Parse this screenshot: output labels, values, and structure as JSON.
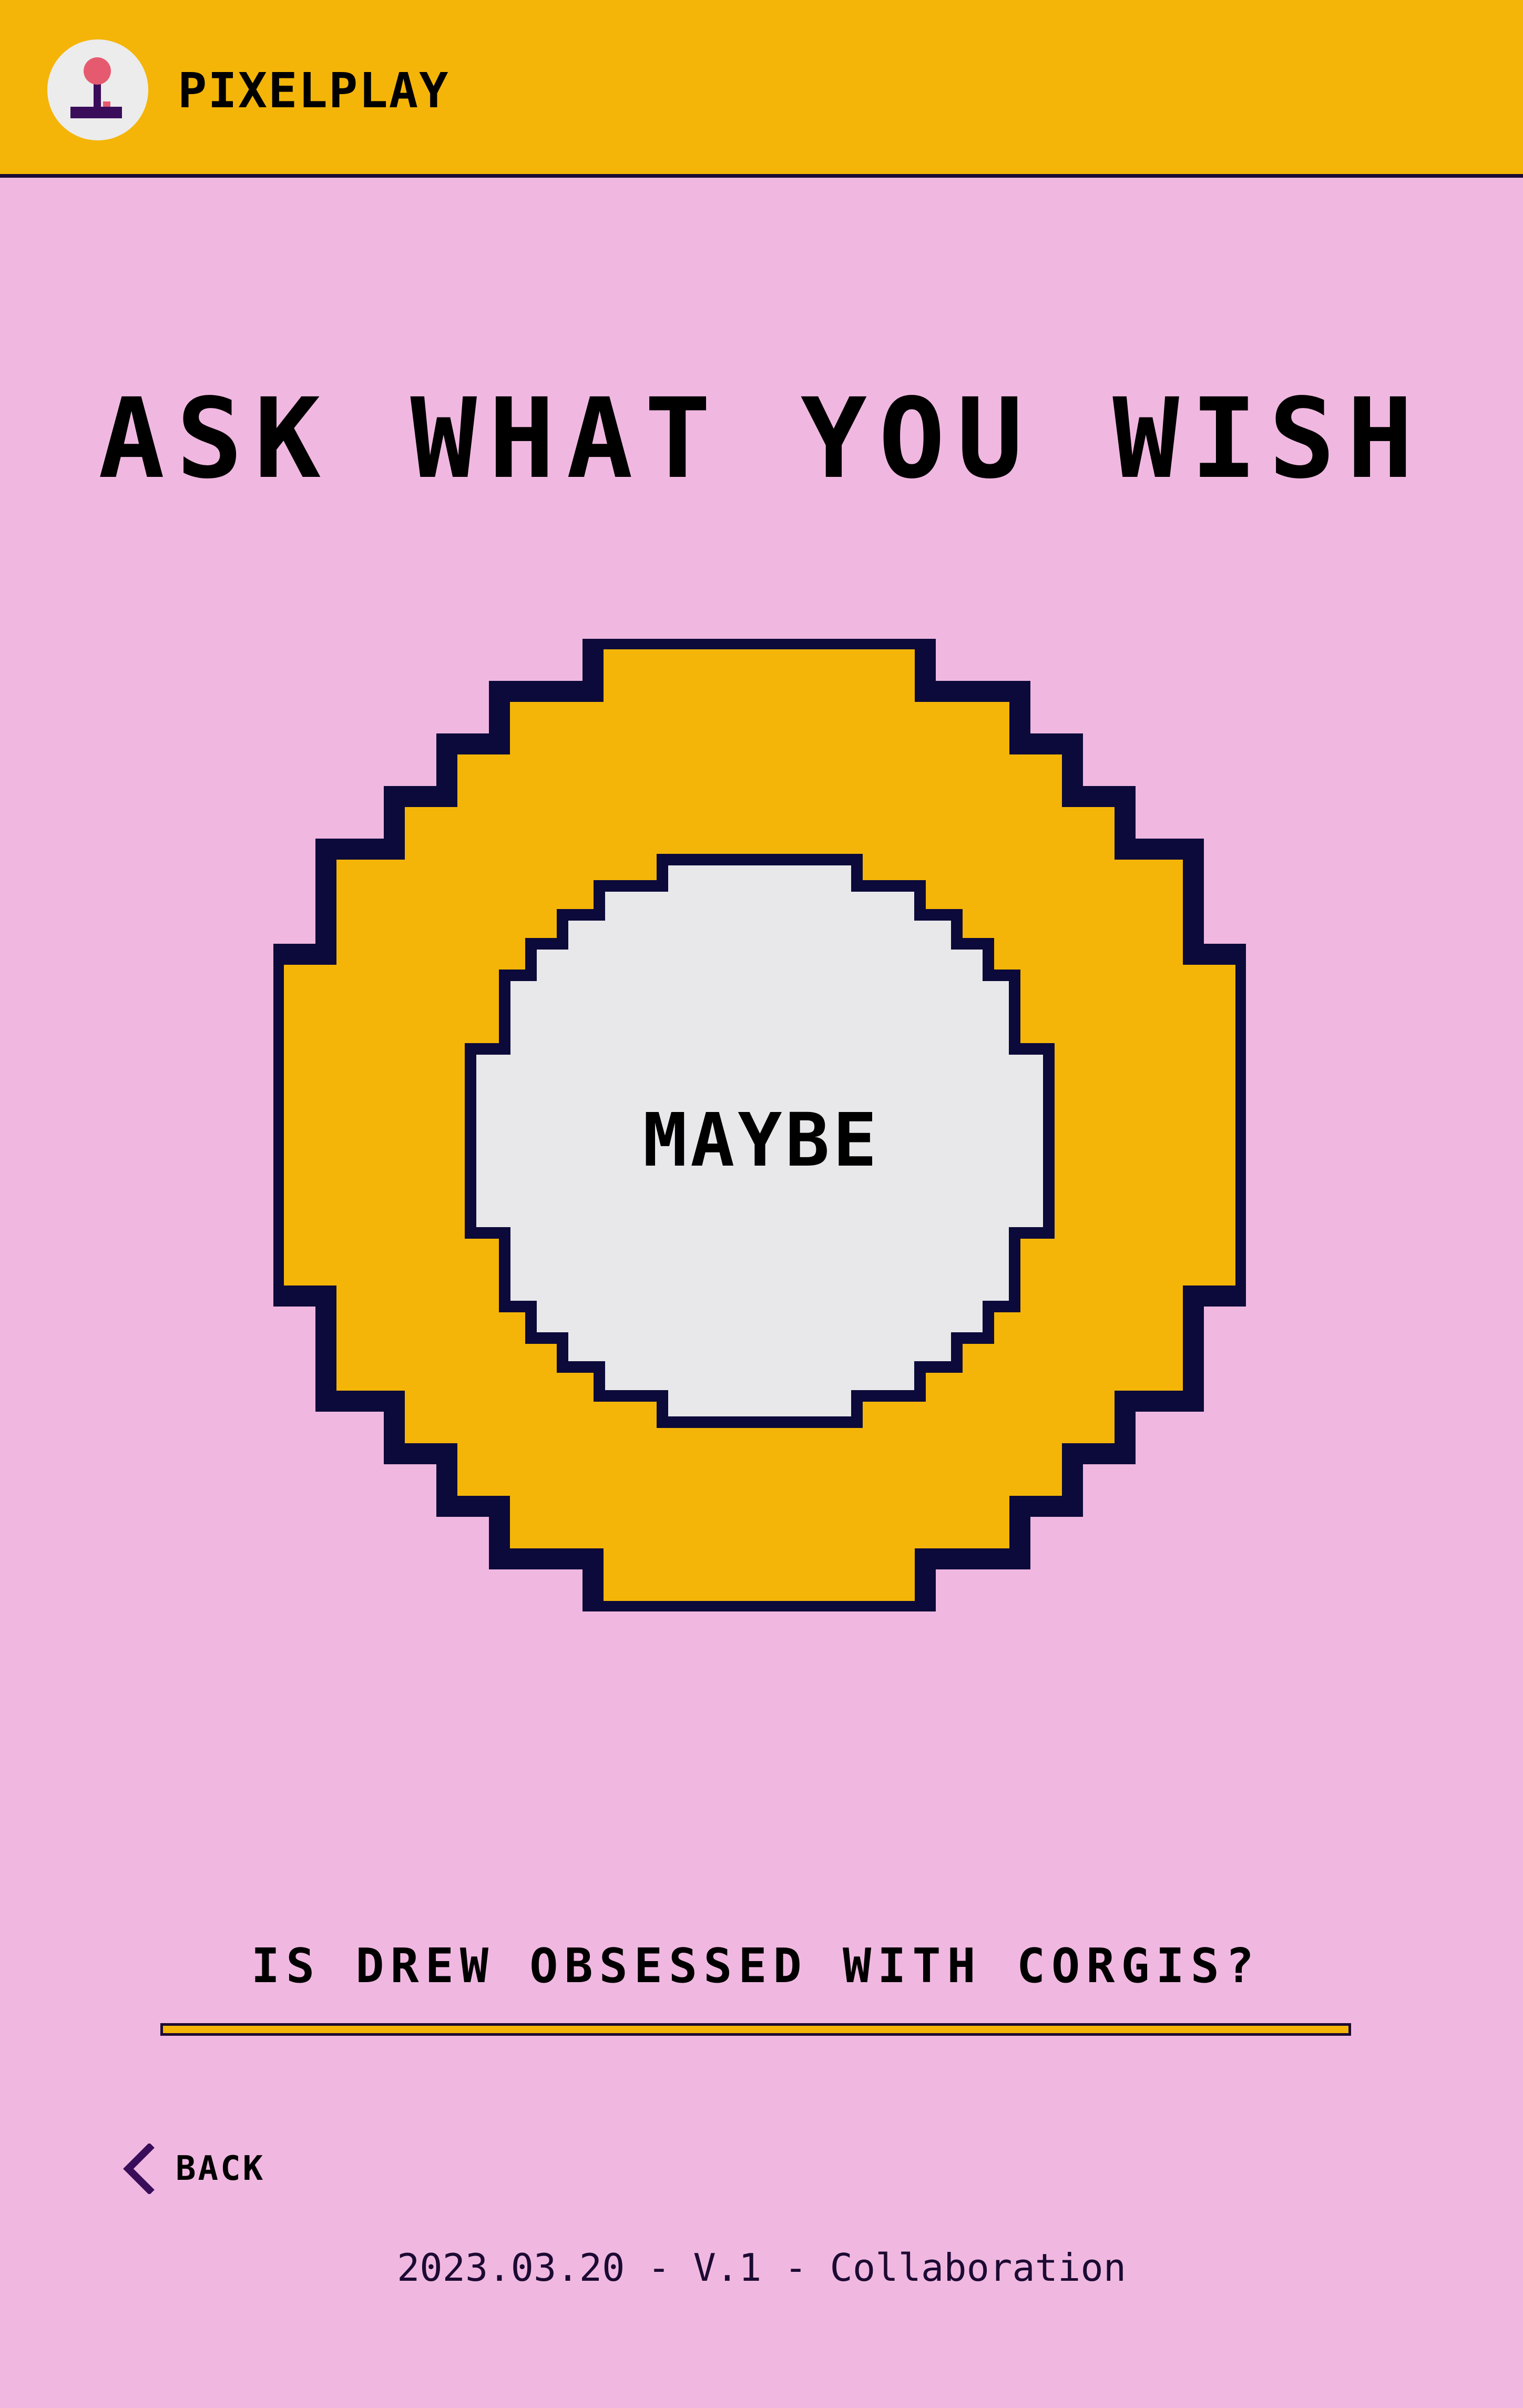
{
  "header": {
    "brand": "PIXELPLAY",
    "logo_icon": "joystick-icon"
  },
  "main": {
    "title": "ASK WHAT YOU WISH",
    "answer": "MAYBE",
    "question": "IS DREW OBSESSED WITH CORGIS?"
  },
  "nav": {
    "back_label": "BACK",
    "back_icon": "chevron-left-icon"
  },
  "footer": {
    "text": "2023.03.20 - V.1 - Collaboration"
  },
  "colors": {
    "background": "#f0b8e0",
    "accent": "#f4b508",
    "outline": "#0c0a3a",
    "ball_face": "#e8e8ea"
  }
}
